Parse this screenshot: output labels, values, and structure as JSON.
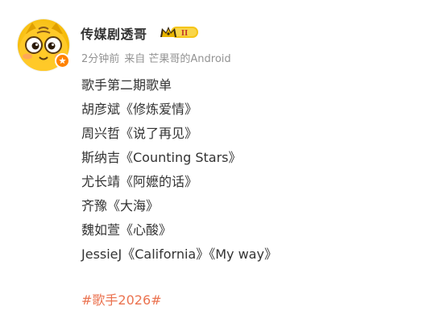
{
  "author": {
    "name": "传媒剧透哥",
    "avatar_icon": "cartoon-cat-avatar-icon",
    "verified_icon": "orange-verified-icon",
    "badge_icon": "crown-vip-badge-icon",
    "badge_label": "II"
  },
  "meta": {
    "time": "2分钟前",
    "source": "来自 芒果哥的Android"
  },
  "post": {
    "lines": [
      "歌手第二期歌单",
      "胡彦斌《修炼爱情》",
      "周兴哲《说了再见》",
      "斯纳吉《Counting Stars》",
      "尤长靖《阿嬷的话》",
      "齐豫《大海》",
      "魏如萱《心酸》",
      "JessieJ《California》《My way》"
    ],
    "hashtag": "#歌手2026#"
  },
  "colors": {
    "text": "#333333",
    "meta": "#939393",
    "hashtag": "#eb7350",
    "verified": "#ff8200",
    "badge": "#f5c518"
  }
}
